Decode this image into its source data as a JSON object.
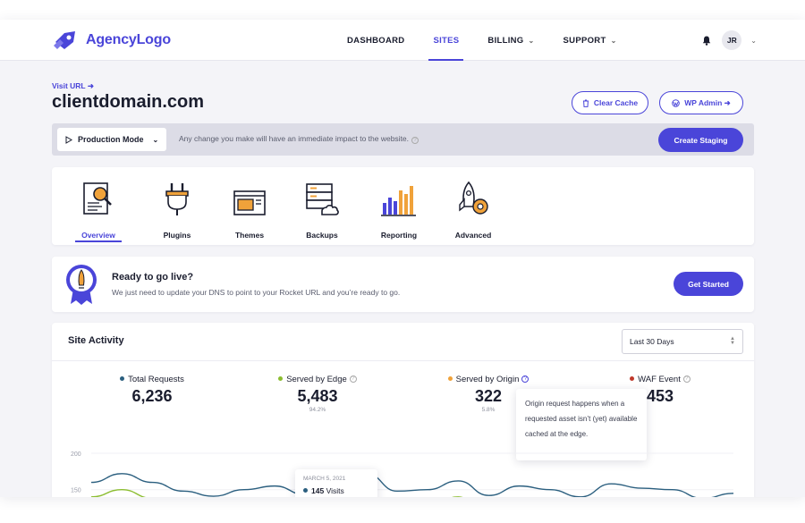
{
  "nav": {
    "logo_text": "AgencyLogo",
    "links": [
      {
        "label": "DASHBOARD",
        "active": false,
        "dropdown": false
      },
      {
        "label": "SITES",
        "active": true,
        "dropdown": false
      },
      {
        "label": "BILLING",
        "active": false,
        "dropdown": true
      },
      {
        "label": "SUPPORT",
        "active": false,
        "dropdown": true
      }
    ],
    "user_initials": "JR",
    "accent": "#4a45d9"
  },
  "site": {
    "visit_url": "Visit URL ➜",
    "domain": "clientdomain.com",
    "clear_cache": "Clear Cache",
    "wp_admin": "WP Admin ➜"
  },
  "mode_bar": {
    "mode": "Production Mode",
    "note": "Any change you make will have an immediate impact to the website.",
    "create_staging": "Create Staging"
  },
  "tabs": [
    {
      "label": "Overview",
      "icon": "overview-icon",
      "active": true
    },
    {
      "label": "Plugins",
      "icon": "plugin-icon",
      "active": false
    },
    {
      "label": "Themes",
      "icon": "themes-icon",
      "active": false
    },
    {
      "label": "Backups",
      "icon": "backups-icon",
      "active": false
    },
    {
      "label": "Reporting",
      "icon": "reporting-icon",
      "active": false
    },
    {
      "label": "Advanced",
      "icon": "advanced-icon",
      "active": false
    }
  ],
  "live": {
    "title": "Ready to go live?",
    "subtitle": "We just need to update your DNS to point to your Rocket URL and you’re ready to go.",
    "button": "Get Started"
  },
  "activity": {
    "title": "Site Activity",
    "range": "Last 30 Days",
    "stats": [
      {
        "label": "Total Requests",
        "value": "6,236",
        "pct": "",
        "color": "#2b5f7f"
      },
      {
        "label": "Served by Edge",
        "value": "5,483",
        "pct": "94.2%",
        "color": "#8bbd2f"
      },
      {
        "label": "Served by Origin",
        "value": "322",
        "pct": "5.8%",
        "color": "#f0a23a"
      },
      {
        "label": "WAF Event",
        "value": "453",
        "pct": "",
        "color": "#c0392b"
      }
    ],
    "origin_tooltip": "Origin request happens when a requested asset isn’t (yet) available cached at the edge.",
    "chart_tip": {
      "date": "MARCH 5, 2021",
      "value": "145",
      "unit": "Visits"
    }
  },
  "chart_data": {
    "type": "line",
    "ylim": [
      100,
      200
    ],
    "yticks": [
      "200",
      "150"
    ],
    "series": [
      {
        "name": "Total Requests",
        "color": "#2b5f7f",
        "values": [
          160,
          172,
          160,
          148,
          141,
          150,
          155,
          143,
          155,
          172,
          148,
          150,
          162,
          142,
          155,
          150,
          140,
          158,
          152,
          150,
          138,
          145
        ]
      },
      {
        "name": "Served by Edge",
        "color": "#8bbd2f",
        "values": [
          140,
          150,
          138,
          118,
          115,
          128,
          135,
          115,
          130,
          140,
          112,
          125,
          140,
          112,
          125,
          125,
          110,
          132,
          120,
          128,
          108,
          120
        ]
      }
    ]
  }
}
